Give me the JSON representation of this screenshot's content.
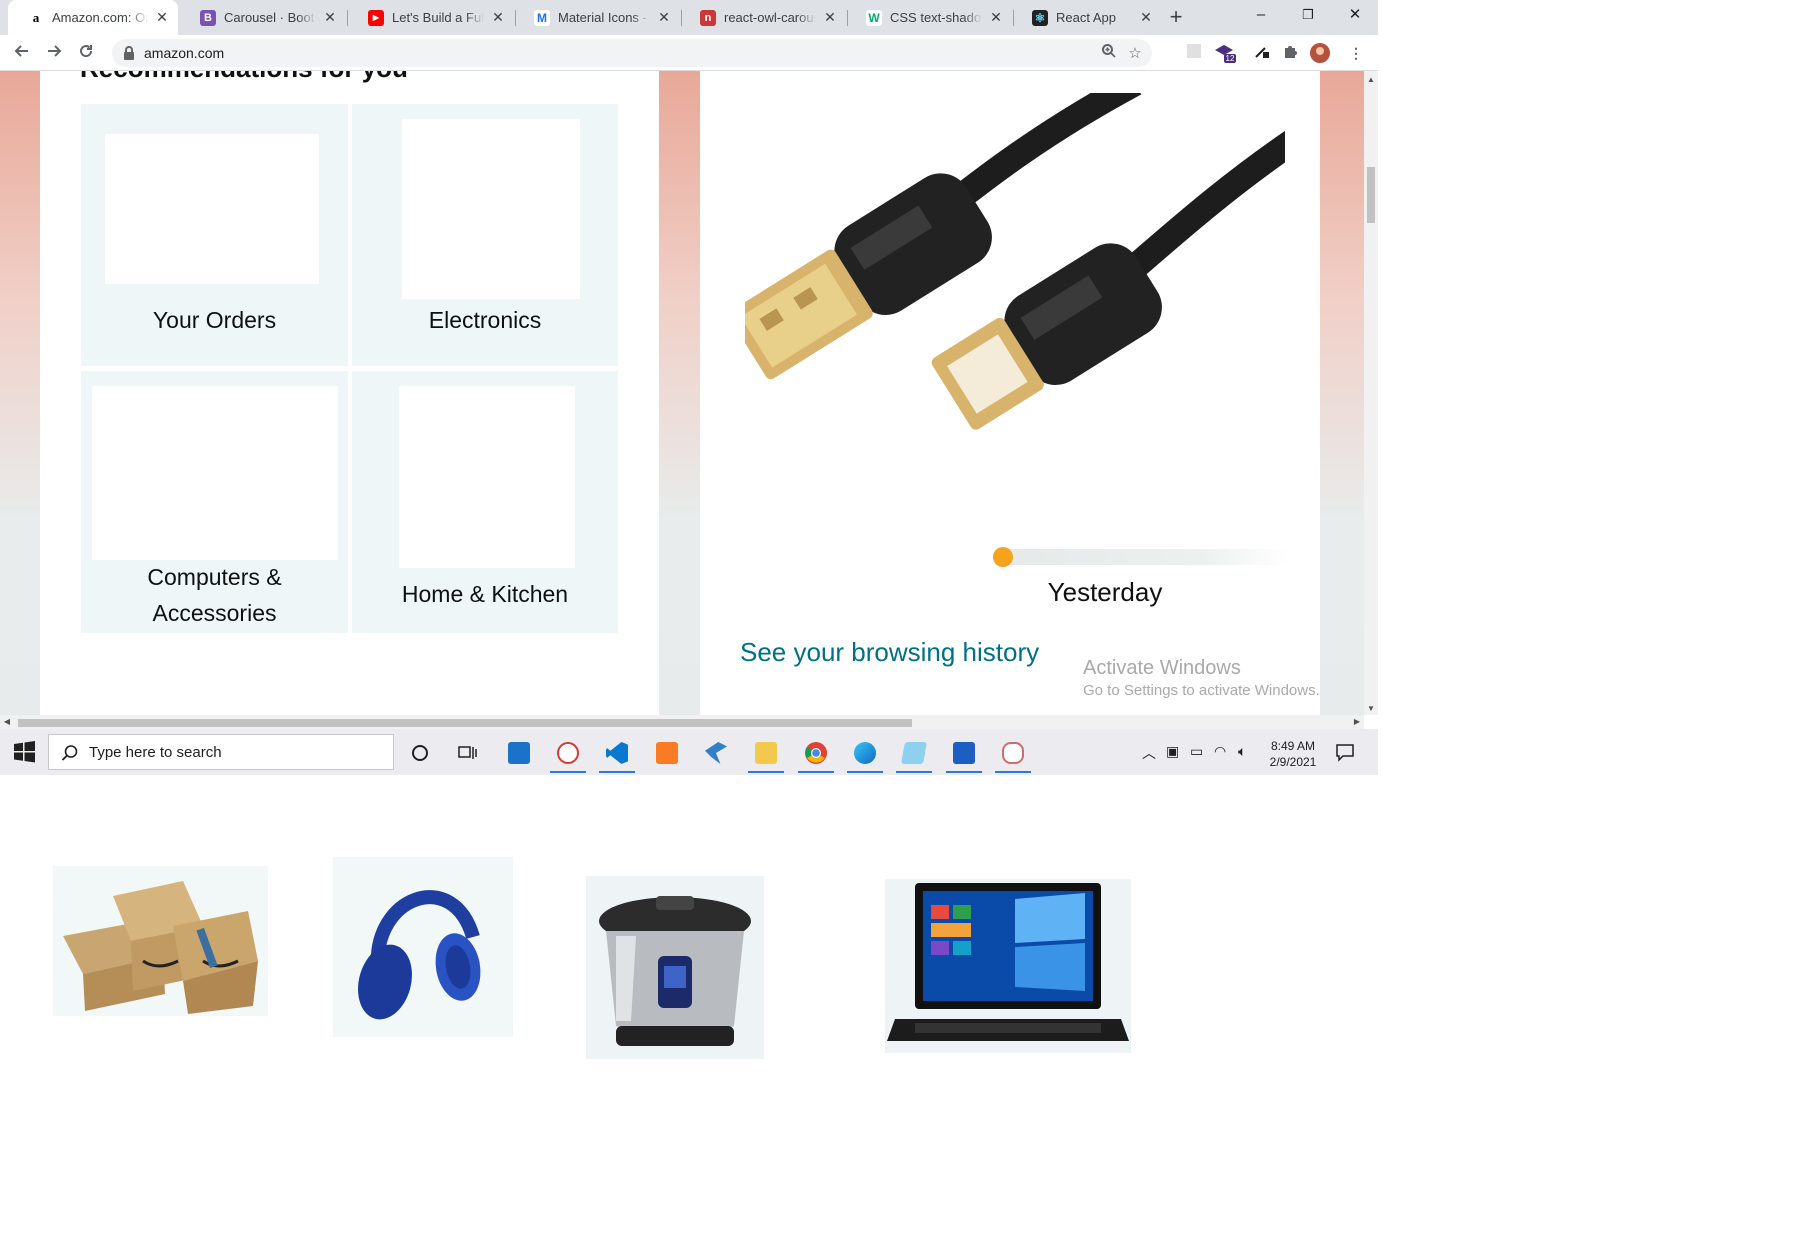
{
  "browser": {
    "tabs": [
      {
        "title": "Amazon.com: Onl",
        "favicon": "amazon-favicon",
        "active": true
      },
      {
        "title": "Carousel · Bootstra",
        "favicon": "bootstrap-favicon"
      },
      {
        "title": "Let's Build a Full-S",
        "favicon": "youtube-favicon"
      },
      {
        "title": "Material Icons - M",
        "favicon": "material-icons-favicon"
      },
      {
        "title": "react-owl-carouse",
        "favicon": "npm-favicon"
      },
      {
        "title": "CSS text-shadow p",
        "favicon": "w3schools-favicon"
      },
      {
        "title": "React App",
        "favicon": "react-favicon"
      }
    ],
    "new_tab": "+",
    "window_controls": {
      "minimize": "–",
      "restore": "❐",
      "close": "✕"
    },
    "url": "amazon.com",
    "extension_badge": "12"
  },
  "page": {
    "recommendations_heading": "Recommendations for you",
    "tiles": [
      {
        "label": "Your Orders"
      },
      {
        "label": "Electronics"
      },
      {
        "label": "Computers & Accessories"
      },
      {
        "label": "Home & Kitchen"
      }
    ],
    "history": {
      "progress": 0.0,
      "period_label": "Yesterday",
      "link": "See your browsing history"
    },
    "watermark": {
      "title": "Activate Windows",
      "subtitle": "Go to Settings to activate Windows."
    }
  },
  "taskbar": {
    "search_placeholder": "Type here to search",
    "time": "8:49 AM",
    "date": "2/9/2021"
  },
  "colors": {
    "accent_orange": "#f7a21b",
    "link_teal": "#007185",
    "tile_bg": "#eef6f8"
  }
}
